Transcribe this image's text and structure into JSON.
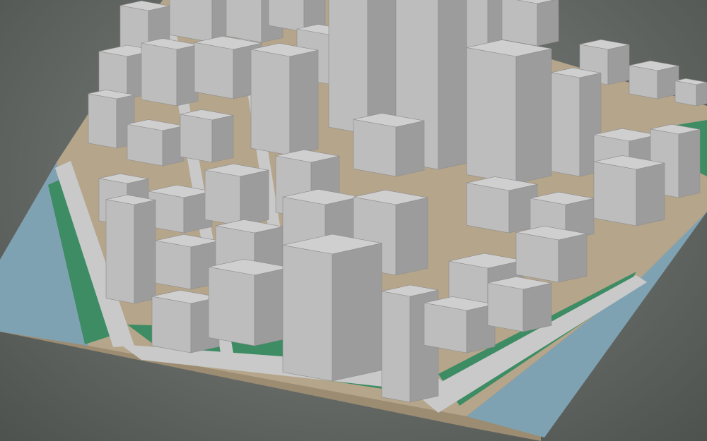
{
  "scene": {
    "kind": "3d-city-model",
    "colors": {
      "background": "#666a66",
      "water": "#7fa2b3",
      "ground": "#b5a58b",
      "base_edge": "#9b8c72",
      "park": "#3d8c64",
      "road": "#c9c9c9",
      "building_top": "#cfcfcf",
      "building_left": "#bdbdbd",
      "building_right": "#9c9c9c"
    }
  }
}
